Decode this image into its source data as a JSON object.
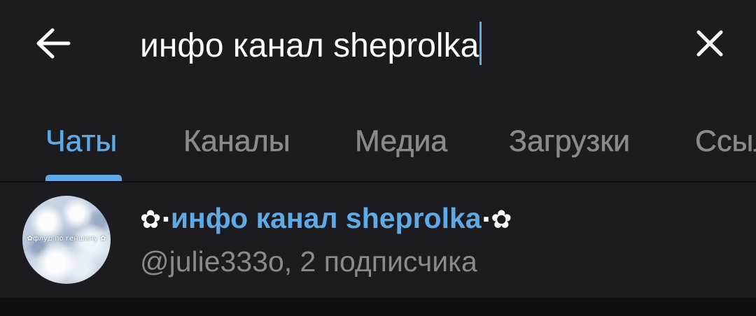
{
  "colors": {
    "background": "#1c1b1f",
    "accent": "#5eaae6",
    "text": "#ffffff",
    "muted": "#8a898e",
    "footer": "#0f0f11"
  },
  "header": {
    "back_icon": "arrow-left-icon",
    "search_value": "инфо канал sheprolka",
    "close_icon": "close-icon"
  },
  "tabs": [
    {
      "label": "Чаты",
      "active": true
    },
    {
      "label": "Каналы",
      "active": false
    },
    {
      "label": "Медиа",
      "active": false
    },
    {
      "label": "Загрузки",
      "active": false
    },
    {
      "label": "Ссыл",
      "active": false
    }
  ],
  "results": [
    {
      "avatar_caption": "✿флуд по геншину ✿",
      "title_prefix": "✿·",
      "title_match": "инфо канал sheprolka",
      "title_suffix": "·✿",
      "subtitle": "@julie333o, 2 подписчика"
    }
  ]
}
